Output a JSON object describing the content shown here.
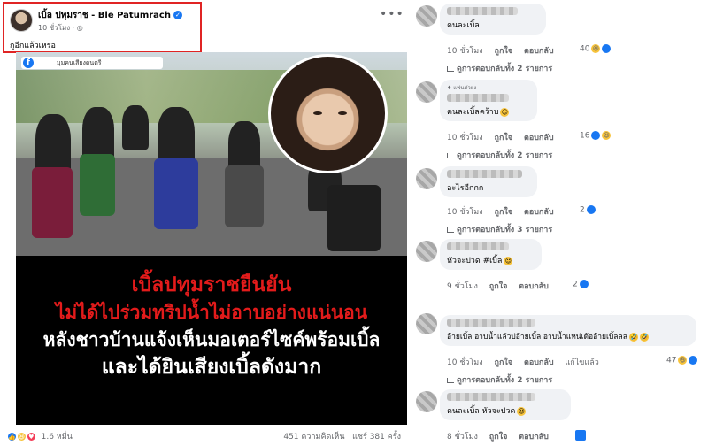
{
  "post": {
    "author": "เบิ้ล ปทุมราช - Ble Patumrach",
    "time": "10 ชั่วโมง",
    "text": "กูอีกแล้วเหรอ",
    "image": {
      "badge_text": "มุมคนเสียงดนตรี",
      "headline_line1": "เบิ้ลปทุมราชยืนยัน",
      "headline_line2": "ไม่ได้ไปร่วมทริปน้ำไม่อาบอย่างแน่นอน",
      "headline_line3": "หลังชาวบ้านแจ้งเห็นมอเตอร์ไซค์พร้อมเบิ้ล",
      "headline_line4": "และได้ยินเสียงเบิ้ลดังมาก"
    },
    "reactions_count": "1.6 หมื่น",
    "comments_count": "451 ความคิดเห็น",
    "shares_count": "แชร์ 381 ครั้ง"
  },
  "comments": [
    {
      "text": "คนละเบิ้ล",
      "time": "10 ชั่วโมง",
      "like": "ถูกใจ",
      "reply": "ตอบกลับ",
      "react_count": "40",
      "replies": "ดูการตอบกลับทั้ง 2 รายการ"
    },
    {
      "tag": "แฟนตัวยง",
      "text": "คนละเบิ้ลคร้าบ",
      "time": "10 ชั่วโมง",
      "like": "ถูกใจ",
      "reply": "ตอบกลับ",
      "react_count": "16",
      "replies": "ดูการตอบกลับทั้ง 2 รายการ"
    },
    {
      "text": "อะไรอีกกก",
      "time": "10 ชั่วโมง",
      "like": "ถูกใจ",
      "reply": "ตอบกลับ",
      "react_count": "2",
      "replies": "ดูการตอบกลับทั้ง 3 รายการ"
    },
    {
      "text": "หัวจะปวด #เบิ้ล",
      "time": "9 ชั่วโมง",
      "like": "ถูกใจ",
      "reply": "ตอบกลับ",
      "react_count": "2"
    },
    {
      "text": "อ้ายเบิ้ล อาบน้ำแล้วบ่อ้ายเบิ้ล อาบน้ำแหน่เด้ออ้ายเบิ้ลลล",
      "time": "10 ชั่วโมง",
      "like": "ถูกใจ",
      "reply": "ตอบกลับ",
      "edited": "แก้ไขแล้ว",
      "react_count": "47",
      "replies": "ดูการตอบกลับทั้ง 2 รายการ"
    },
    {
      "text": "คนละเบิ้ล หัวจะปวด",
      "time": "8 ชั่วโมง",
      "like": "ถูกใจ",
      "reply": "ตอบกลับ"
    }
  ],
  "colors": {
    "accent": "#1877f2",
    "highlight_border": "#e02424",
    "headline_red": "#e31b1b"
  }
}
